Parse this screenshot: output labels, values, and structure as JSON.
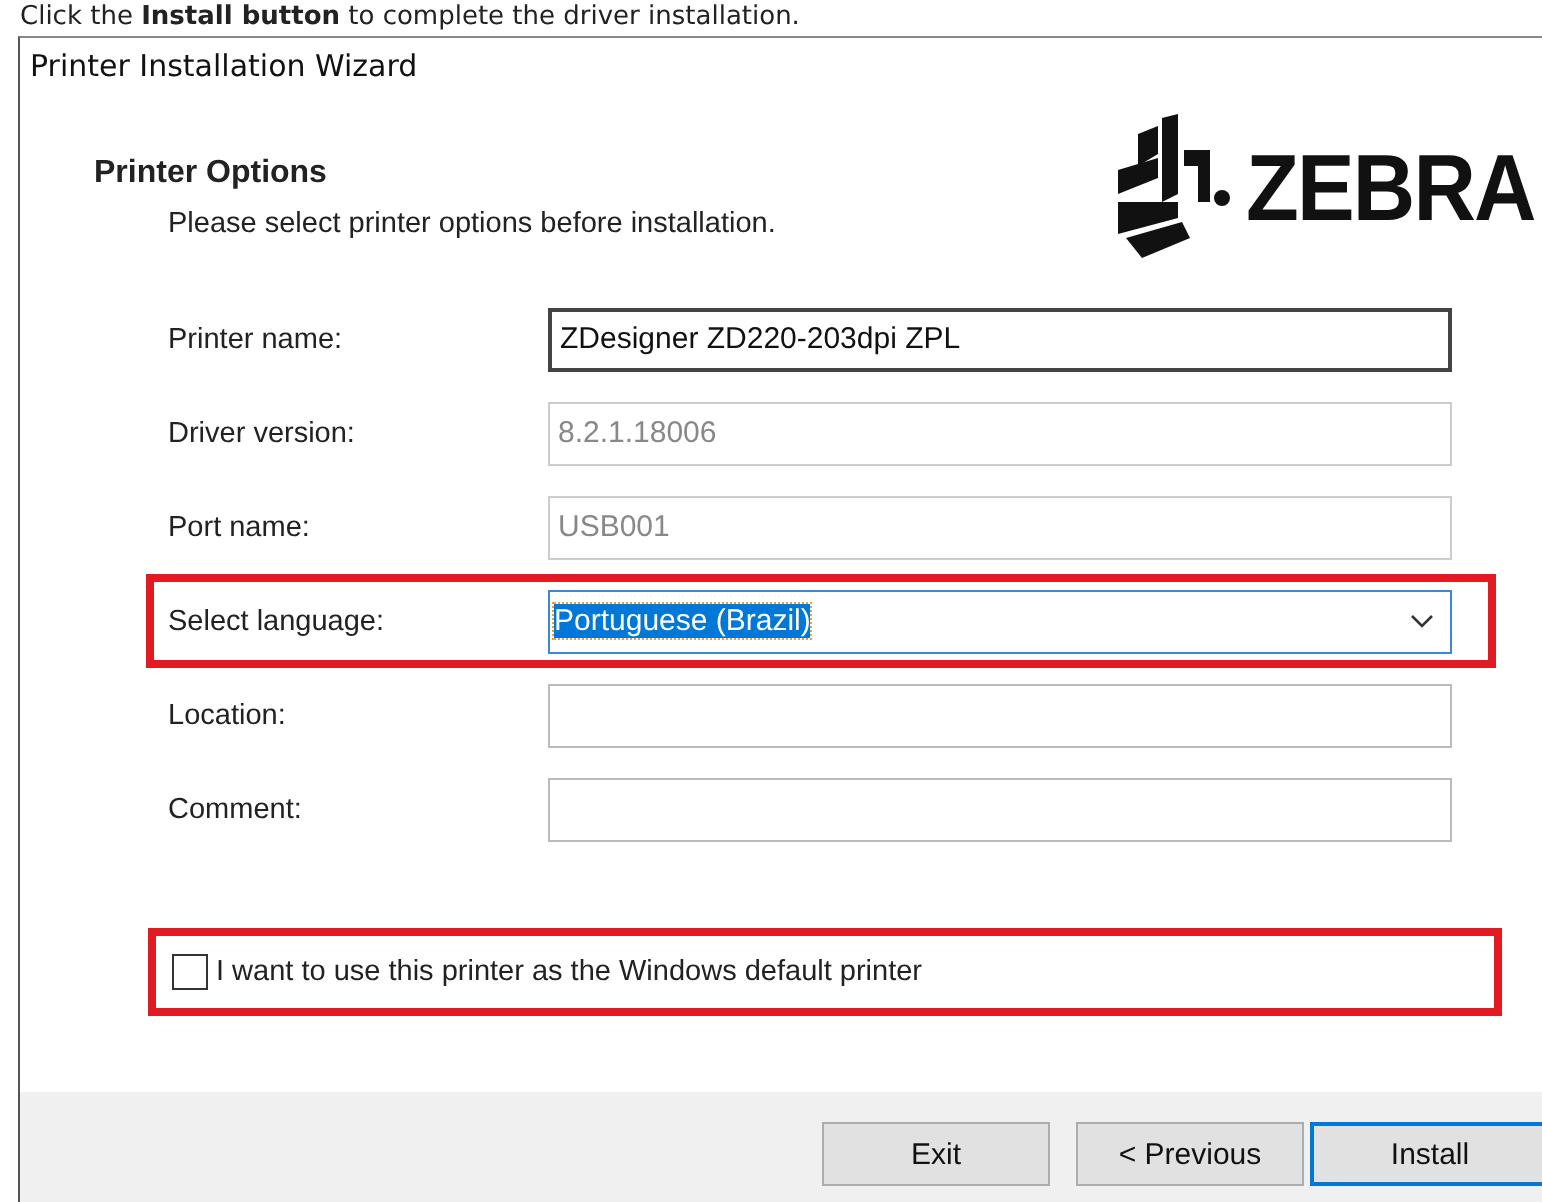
{
  "caption": "Click the **Install button** to complete the driver installation.",
  "window": {
    "title": "Printer Installation Wizard"
  },
  "header": {
    "title": "Printer Options",
    "subtitle": "Please select printer options before installation.",
    "logo_text": "ZEBRA"
  },
  "fields": [
    {
      "kind": "text",
      "label": "Printer name:",
      "value": "ZDesigner ZD220-203dpi ZPL",
      "disabled": false,
      "highlighted": false
    },
    {
      "kind": "text",
      "label": "Driver version:",
      "value": "8.2.1.18006",
      "disabled": true,
      "highlighted": false
    },
    {
      "kind": "text",
      "label": "Port name:",
      "value": "USB001",
      "disabled": true,
      "highlighted": false
    },
    {
      "kind": "dropdown",
      "label": "Select language:",
      "value": "Portuguese (Brazil)",
      "disabled": false,
      "highlighted": true,
      "text_selected": true
    },
    {
      "kind": "text",
      "label": "Location:",
      "disabled": false,
      "highlighted": false
    },
    {
      "kind": "text",
      "label": "Comment:",
      "disabled": false,
      "highlighted": false
    }
  ],
  "default_printer": {
    "label": "I want to use this printer as the Windows default printer",
    "checked": false,
    "highlighted": true
  },
  "buttons": [
    {
      "label": "Exit",
      "default": false
    },
    {
      "label": "< Previous",
      "default": false
    },
    {
      "label": "Install",
      "default": true
    }
  ]
}
